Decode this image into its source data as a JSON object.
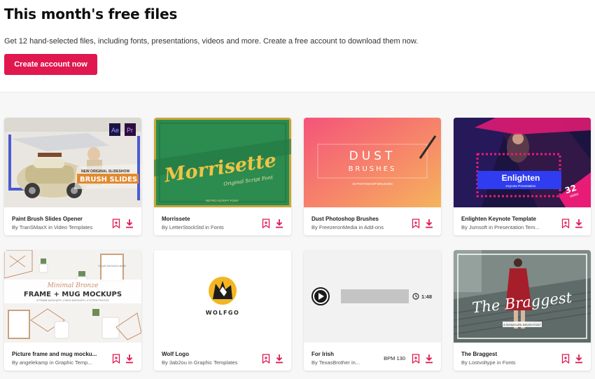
{
  "hero": {
    "title": "This month's free files",
    "subtitle": "Get 12 hand-selected files, including fonts, presentations, videos and more. Create a free account to download them now.",
    "cta_label": "Create account now"
  },
  "colors": {
    "accent": "#e0184f",
    "text": "#0e0e0e",
    "muted": "#555555"
  },
  "cards": [
    {
      "title": "Paint Brush Slides Opener",
      "author": "By TranSMaxX in Video Templates",
      "thumb": {
        "text_main": "BRUSH SLIDES",
        "text_sub": "NEW ORIGINAL SLIDESHOW",
        "badge_ae": "Ae",
        "badge_pr": "Pr"
      }
    },
    {
      "title": "Morrissete",
      "author": "By LetterStockStd in Fonts",
      "thumb": {
        "text_main": "Morrisette",
        "text_sub": "Original Script Font",
        "text_small": "RETRO SCRIPT FONT"
      }
    },
    {
      "title": "Dust Photoshop Brushes",
      "author": "By FreezeronMedia in Add-ons",
      "thumb": {
        "text_main": "DUST",
        "text_sub": "BRUSHES",
        "text_small": "10 PHOTOSHOP BRUSHES"
      }
    },
    {
      "title": "Enlighten Keynote Template",
      "author": "By Jumsoft in Presentation Tem...",
      "thumb": {
        "text_main": "Enlighten",
        "text_sub": "Keynote Presentation",
        "badge_num": "32",
        "badge_txt": "slides"
      }
    },
    {
      "title": "Picture frame and mug mocku...",
      "author": "By angelekamp in Graphic Temp...",
      "thumb": {
        "text_script": "Minimal Bronze",
        "text_main": "FRAME + MUG MOCKUPS",
        "text_small": "5 FRAME MOCKUPS • 2 MUG MOCKUPS • 4 STOCK PHOTOS",
        "frame_text": "YOUR DESIGN HERE"
      }
    },
    {
      "title": "Wolf Logo",
      "author": "By 3ab2ou in Graphic Templates",
      "thumb": {
        "text_main": "WOLFGO"
      }
    },
    {
      "title": "For Irish",
      "author": "By TexasBrother in...",
      "bpm": "BPM 130",
      "thumb": {
        "duration": "1:48"
      }
    },
    {
      "title": "The Braggest",
      "author": "By Lostvoltype in Fonts",
      "thumb": {
        "text_main": "The Braggest",
        "text_small": "A SIGNATURE BRUSH FONT"
      }
    }
  ]
}
